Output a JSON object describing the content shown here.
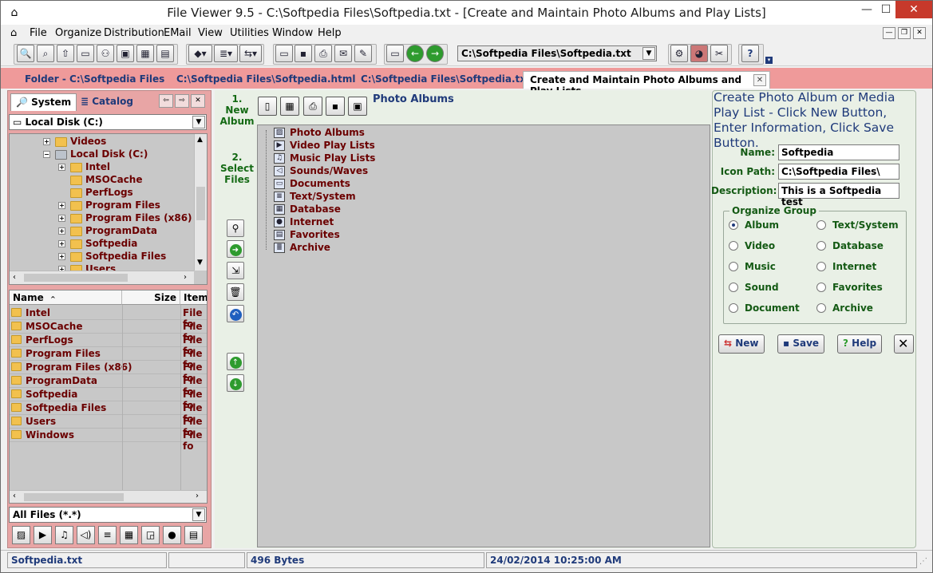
{
  "window": {
    "title": "File Viewer 9.5 - C:\\Softpedia Files\\Softpedia.txt - [Create and Maintain Photo Albums and Play Lists]",
    "min": "—",
    "max": "☐",
    "close": "✕"
  },
  "menu": [
    "File",
    "Organize",
    "Distribution",
    "EMail",
    "View",
    "Utilities",
    "Window",
    "Help"
  ],
  "toolbar": {
    "path": "C:\\Softpedia Files\\Softpedia.txt"
  },
  "tabs": [
    {
      "label": "Folder - C:\\Softpedia Files"
    },
    {
      "label": "C:\\Softpedia Files\\Softpedia.html"
    },
    {
      "label": "C:\\Softpedia Files\\Softpedia.txt"
    },
    {
      "label": "Create and Maintain Photo Albums and Play Lists"
    }
  ],
  "left": {
    "tab_system": "System",
    "tab_catalog": "Catalog",
    "drive": "Local Disk (C:)",
    "tree": [
      {
        "label": "Videos",
        "indent": 2,
        "pm": "+"
      },
      {
        "label": "Local Disk (C:)",
        "indent": 2,
        "pm": "−"
      },
      {
        "label": "Intel",
        "indent": 3,
        "pm": "+"
      },
      {
        "label": "MSOCache",
        "indent": 3,
        "pm": ""
      },
      {
        "label": "PerfLogs",
        "indent": 3,
        "pm": ""
      },
      {
        "label": "Program Files",
        "indent": 3,
        "pm": "+"
      },
      {
        "label": "Program Files (x86)",
        "indent": 3,
        "pm": "+"
      },
      {
        "label": "ProgramData",
        "indent": 3,
        "pm": "+"
      },
      {
        "label": "Softpedia",
        "indent": 3,
        "pm": "+"
      },
      {
        "label": "Softpedia Files",
        "indent": 3,
        "pm": "+"
      },
      {
        "label": "Users",
        "indent": 3,
        "pm": "+"
      }
    ],
    "list_headers": {
      "name": "Name",
      "size": "Size",
      "item": "Item"
    },
    "list": [
      {
        "name": "Intel",
        "size": "",
        "item": "File fo"
      },
      {
        "name": "MSOCache",
        "size": "",
        "item": "File fo"
      },
      {
        "name": "PerfLogs",
        "size": "",
        "item": "File fo"
      },
      {
        "name": "Program Files",
        "size": "",
        "item": "File fo"
      },
      {
        "name": "Program Files (x86)",
        "size": "",
        "item": "File fo"
      },
      {
        "name": "ProgramData",
        "size": "",
        "item": "File fo"
      },
      {
        "name": "Softpedia",
        "size": "",
        "item": "File fo"
      },
      {
        "name": "Softpedia Files",
        "size": "",
        "item": "File fo"
      },
      {
        "name": "Users",
        "size": "",
        "item": "File fo"
      },
      {
        "name": "Windows",
        "size": "",
        "item": "File fo"
      }
    ],
    "filter": "All Files (*.*)"
  },
  "middle": {
    "step1": [
      "1.",
      "New",
      "Album"
    ],
    "step2": [
      "2.",
      "Select",
      "Files"
    ],
    "heading": "Photo Albums",
    "items": [
      {
        "label": "Photo Albums",
        "icon": "photo-album-icon"
      },
      {
        "label": "Video Play Lists",
        "icon": "video-icon"
      },
      {
        "label": "Music Play Lists",
        "icon": "music-icon"
      },
      {
        "label": "Sounds/Waves",
        "icon": "sound-icon"
      },
      {
        "label": "Documents",
        "icon": "document-icon"
      },
      {
        "label": "Text/System",
        "icon": "text-icon"
      },
      {
        "label": "Database",
        "icon": "database-icon"
      },
      {
        "label": "Internet",
        "icon": "globe-icon"
      },
      {
        "label": "Favorites",
        "icon": "favorites-icon"
      },
      {
        "label": "Archive",
        "icon": "archive-icon"
      }
    ]
  },
  "right": {
    "title": "Create Photo Album or Media Play List - Click New Button, Enter Information, Click Save Button.",
    "name_label": "Name:",
    "name_value": "Softpedia",
    "iconpath_label": "Icon Path:",
    "iconpath_value": "C:\\Softpedia Files\\",
    "desc_label": "Description:",
    "desc_value": "This is a Softpedia test",
    "group_label": "Organize Group",
    "radios": [
      {
        "label": "Album",
        "checked": true
      },
      {
        "label": "Text/System",
        "checked": false
      },
      {
        "label": "Video",
        "checked": false
      },
      {
        "label": "Database",
        "checked": false
      },
      {
        "label": "Music",
        "checked": false
      },
      {
        "label": "Internet",
        "checked": false
      },
      {
        "label": "Sound",
        "checked": false
      },
      {
        "label": "Favorites",
        "checked": false
      },
      {
        "label": "Document",
        "checked": false
      },
      {
        "label": "Archive",
        "checked": false
      }
    ],
    "btn_new": "New",
    "btn_save": "Save",
    "btn_help": "Help"
  },
  "status": {
    "file": "Softpedia.txt",
    "size": "496 Bytes",
    "date": "24/02/2014 10:25:00 AM"
  },
  "colors": {
    "accent_pink": "#ef9a9a",
    "panel_green": "#e9f0e6",
    "item_text": "#6b0000",
    "label_green": "#145a14",
    "link_blue": "#1f3a7a"
  }
}
